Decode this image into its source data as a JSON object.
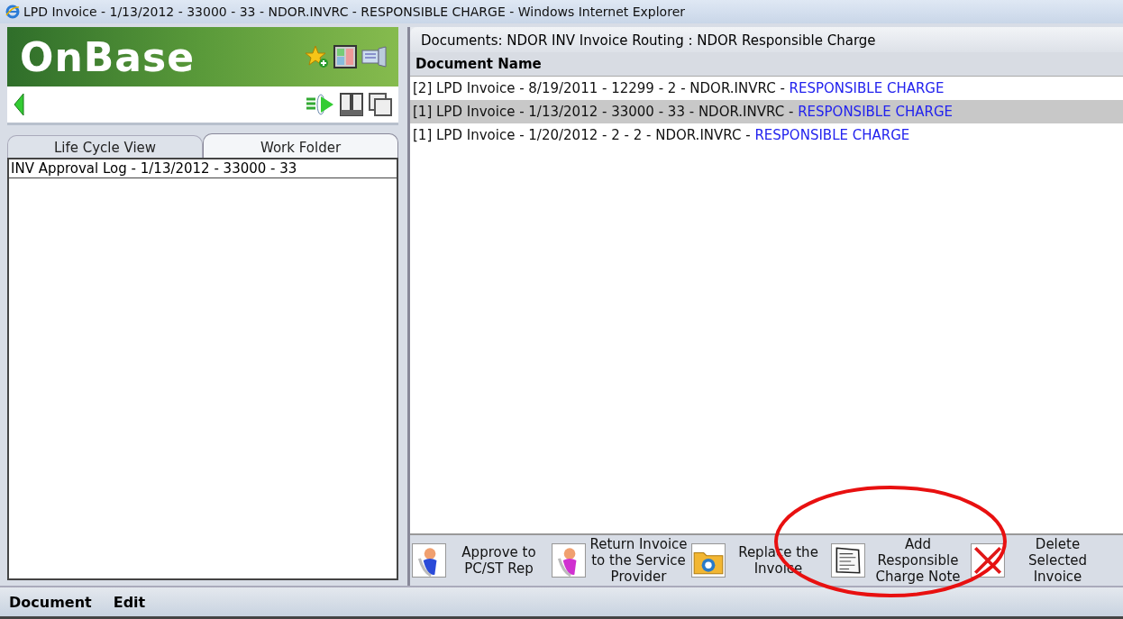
{
  "window": {
    "title": "LPD Invoice - 1/13/2012 - 33000 - 33 - NDOR.INVRC - RESPONSIBLE CHARGE - Windows Internet Explorer"
  },
  "logo": {
    "text": "OnBase"
  },
  "left_tabs": [
    {
      "label": "Life Cycle View",
      "selected": false
    },
    {
      "label": "Work Folder",
      "selected": true
    }
  ],
  "left_list": [
    "INV Approval Log - 1/13/2012 - 33000 - 33"
  ],
  "documents": {
    "title": "Documents: NDOR INV Invoice Routing : NDOR Responsible Charge",
    "column": "Document Name",
    "rows": [
      {
        "name": "[2] LPD Invoice - 8/19/2011 - 12299 - 2 - NDOR.INVRC - ",
        "link": "RESPONSIBLE CHARGE",
        "selected": false
      },
      {
        "name": "[1] LPD Invoice - 1/13/2012 - 33000 - 33 - NDOR.INVRC - ",
        "link": "RESPONSIBLE CHARGE",
        "selected": true
      },
      {
        "name": "[1] LPD Invoice - 1/20/2012 - 2 - 2 - NDOR.INVRC - ",
        "link": "RESPONSIBLE CHARGE",
        "selected": false
      }
    ]
  },
  "actions": [
    {
      "kind": "person-blue",
      "label": "Approve to PC/ST Rep"
    },
    {
      "kind": "person-pink",
      "label": "Return Invoice to the Service Provider"
    },
    {
      "kind": "folder",
      "label": "Replace the Invoice"
    },
    {
      "kind": "note",
      "label": "Add Responsible Charge Note"
    },
    {
      "kind": "delete",
      "label": "Delete Selected Invoice"
    }
  ],
  "menu": [
    "Document",
    "Edit"
  ]
}
